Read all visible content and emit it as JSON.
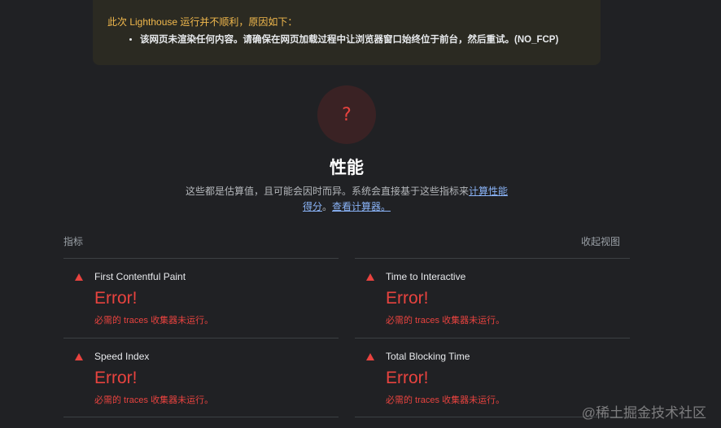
{
  "warning": {
    "title": "此次 Lighthouse 运行并不顺利，原因如下：",
    "items": [
      "该网页未渲染任何内容。请确保在网页加载过程中让浏览器窗口始终位于前台，然后重试。(NO_FCP)"
    ]
  },
  "gauge": {
    "mark": "?"
  },
  "category": {
    "title": "性能",
    "desc_prefix": "这些都是估算值，且可能会因时而异。系统会直接基于这些指标来",
    "desc_link1": "计算性能得分",
    "desc_mid": "。",
    "desc_link2": "查看计算器。"
  },
  "metrics_header": {
    "label": "指标",
    "toggle": "收起视图"
  },
  "metrics": [
    {
      "name": "First Contentful Paint",
      "value": "Error!",
      "note": "必需的 traces 收集器未运行。"
    },
    {
      "name": "Time to Interactive",
      "value": "Error!",
      "note": "必需的 traces 收集器未运行。"
    },
    {
      "name": "Speed Index",
      "value": "Error!",
      "note": "必需的 traces 收集器未运行。"
    },
    {
      "name": "Total Blocking Time",
      "value": "Error!",
      "note": "必需的 traces 收集器未运行。"
    }
  ],
  "watermark": "@稀土掘金技术社区",
  "colors": {
    "background": "#202124",
    "warning_bg": "#2b2a22",
    "warning_text": "#f2b94d",
    "error": "#e8433f",
    "link": "#8ab4f8"
  }
}
